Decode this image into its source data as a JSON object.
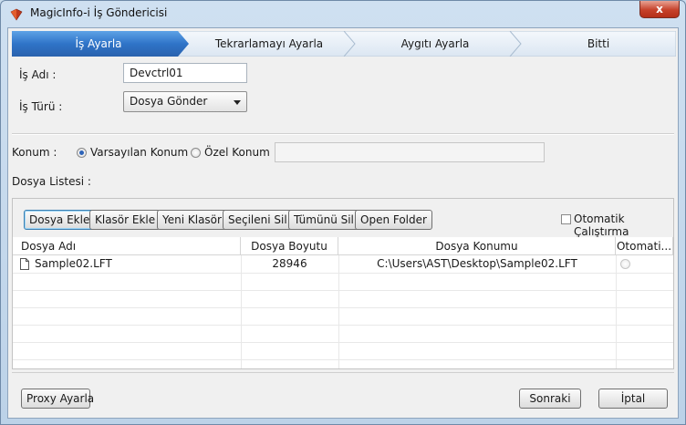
{
  "window": {
    "title": "MagicInfo-i İş Göndericisi",
    "close_label": "x"
  },
  "steps": [
    "İş Ayarla",
    "Tekrarlamayı Ayarla",
    "Aygıtı Ayarla",
    "Bitti"
  ],
  "form": {
    "job_name_label": "İş Adı :",
    "job_name_value": "Devctrl01",
    "job_type_label": "İş Türü :",
    "job_type_value": "Dosya Gönder"
  },
  "location": {
    "label": "Konum :",
    "default_option": "Varsayılan Konum",
    "custom_option": "Özel Konum",
    "custom_path_value": ""
  },
  "file_list": {
    "label": "Dosya Listesi :",
    "buttons": [
      "Dosya Ekle",
      "Klasör Ekle",
      "Yeni Klasör",
      "Seçileni Sil",
      "Tümünü Sil",
      "Open Folder"
    ],
    "auto_run_label": "Otomatik Çalıştırma",
    "columns": [
      "Dosya Adı",
      "Dosya Boyutu",
      "Dosya Konumu",
      "Otomati..."
    ],
    "rows": [
      {
        "name": "Sample02.LFT",
        "size": "28946",
        "location": "C:\\Users\\AST\\Desktop\\Sample02.LFT"
      }
    ]
  },
  "footer": {
    "proxy_label": "Proxy Ayarla",
    "next_label": "Sonraki",
    "cancel_label": "İptal"
  },
  "colors": {
    "active_step": "#2a6ebd",
    "step_bg": "#e3ebf5",
    "close": "#c6412a"
  }
}
